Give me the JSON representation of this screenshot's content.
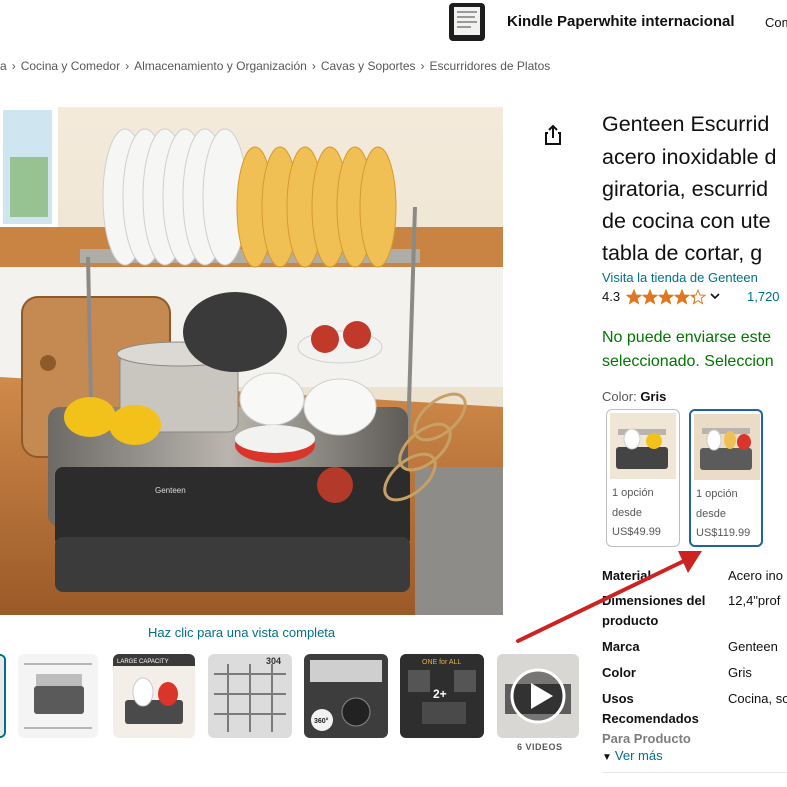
{
  "banner": {
    "kindle_title": "Kindle Paperwhite internacional",
    "kindle_extra": "Com"
  },
  "breadcrumb": {
    "lead": "a",
    "items": [
      "Cocina y Comedor",
      "Almacenamiento y Organización",
      "Cavas y Soportes",
      "Escurridores de Platos"
    ],
    "separator": "›"
  },
  "gallery": {
    "brand_mark": "Genteen",
    "view_full_label": "Haz clic para una vista completa",
    "thumbs": [
      {
        "icon": "product-angle-thumbnail"
      },
      {
        "icon": "dimensions-thumbnail"
      },
      {
        "icon": "large-capacity-thumbnail",
        "caption": "LARGE CAPACITY"
      },
      {
        "icon": "stainless-steel-thumbnail",
        "caption": "304"
      },
      {
        "icon": "rotating-spout-thumbnail",
        "badge": "360°"
      },
      {
        "icon": "one-for-all-thumbnail",
        "caption": "ONE for ALL",
        "badge": "2+"
      },
      {
        "icon": "video-play-thumbnail"
      }
    ],
    "videos_label": "6 VIDEOS"
  },
  "product": {
    "title_lines": [
      "Genteen Escurrid",
      "acero inoxidable d",
      "giratoria, escurrid",
      "de cocina con ute",
      "tabla de cortar, g"
    ],
    "store_link": "Visita la tienda de Genteen",
    "rating": "4.3",
    "rating_fraction": 0.86,
    "rating_count": "1,720",
    "shipping_lines": [
      "No puede enviarse este",
      "seleccionado. Seleccion"
    ]
  },
  "color": {
    "label": "Color:",
    "selected": "Gris",
    "options": [
      {
        "line1": "1 opción",
        "line2": "desde",
        "price": "US$49.99"
      },
      {
        "line1": "1 opción",
        "line2": "desde",
        "price": "US$119.99"
      }
    ]
  },
  "specs": [
    {
      "label_lines": [
        "Material"
      ],
      "value": "Acero ino"
    },
    {
      "label_lines": [
        "Dimensiones del",
        "producto"
      ],
      "value": "12,4\"prof"
    },
    {
      "label_lines": [
        "Marca"
      ],
      "value": "Genteen"
    },
    {
      "label_lines": [
        "Color"
      ],
      "value": "Gris"
    },
    {
      "label_lines": [
        "Usos",
        "Recomendados",
        "Para Producto"
      ],
      "value": "Cocina, so"
    }
  ],
  "see_more": "Ver más",
  "colors": {
    "link": "#007185",
    "ship": "#007600",
    "star": "#de7921",
    "selected_border": "#2162a1",
    "annotation_arrow": "#cc2222"
  }
}
